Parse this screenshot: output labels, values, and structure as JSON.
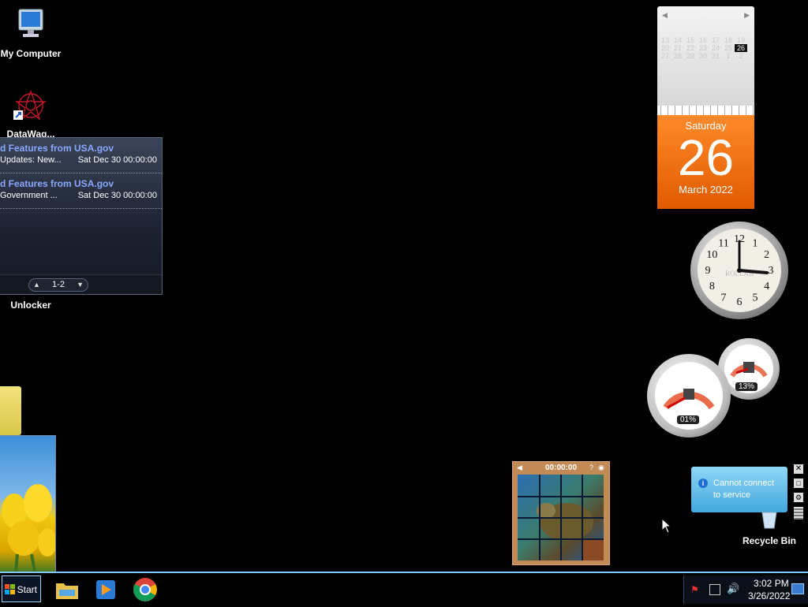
{
  "desktop": {
    "icons": [
      {
        "label": "My Computer"
      },
      {
        "label": "DataWag..."
      },
      {
        "label": "Unlocker"
      },
      {
        "label": "Recycle Bin"
      }
    ]
  },
  "feed_gadget": {
    "items": [
      {
        "title": "d Features from USA.gov",
        "subtitle": "Updates: New...",
        "date": "Sat Dec 30 00:00:00"
      },
      {
        "title": "d Features from USA.gov",
        "subtitle": "Government ...",
        "date": "Sat Dec 30 00:00:00"
      }
    ],
    "pager": "1-2"
  },
  "calendar_gadget": {
    "weekday": "Saturday",
    "day": "26",
    "month_year": "March 2022",
    "grid": [
      "13",
      "14",
      "15",
      "16",
      "17",
      "18",
      "19",
      "20",
      "21",
      "22",
      "23",
      "24",
      "25",
      "26",
      "27",
      "28",
      "29",
      "30",
      "31",
      "1",
      "2"
    ]
  },
  "clock_gadget": {
    "numerals": [
      "12",
      "1",
      "2",
      "3",
      "4",
      "5",
      "6",
      "7",
      "8",
      "9",
      "10",
      "11"
    ],
    "brand": "ROLLAB"
  },
  "meter_gadget": {
    "cpu": "01%",
    "memory": "13%"
  },
  "puzzle_gadget": {
    "time": "00:00:00"
  },
  "notification": {
    "text_line1": "Cannot connect",
    "text_line2": "to service"
  },
  "taskbar": {
    "start_label": "Start",
    "time": "3:02 PM",
    "date": "3/26/2022"
  },
  "colors": {
    "taskbar_accent": "#7fc6ff",
    "calendar_orange": "#e86a10",
    "feed_link": "#8aa8ff"
  }
}
